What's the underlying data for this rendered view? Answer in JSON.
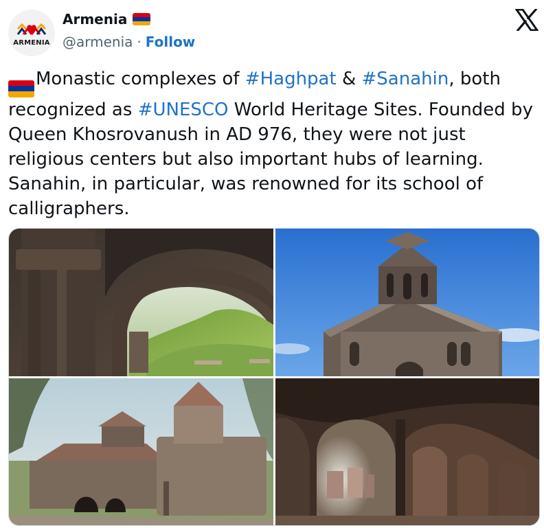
{
  "account": {
    "display_name": "Armenia",
    "handle": "@armenia",
    "separator": "·",
    "follow_label": "Follow",
    "avatar_text": "ARMENIA",
    "flag_colors": [
      "#d90012",
      "#0033a0",
      "#f2a800"
    ]
  },
  "header": {
    "x_logo_icon": "x-logo-icon"
  },
  "tweet": {
    "seg1": "Monastic complexes of ",
    "tag1": "#Haghpat",
    "seg2": " & ",
    "tag2": "#Sanahin",
    "seg3": ", both recognized as ",
    "tag3": "#UNESCO",
    "seg4": " World Heritage Sites. Founded by Queen Khosrovanush in AD 976, they were not just religious centers but also important hubs of learning. Sanahin, in particular, was renowned for its school of calligraphers."
  },
  "media": {
    "photos": [
      {
        "name": "photo-stone-arch-valley"
      },
      {
        "name": "photo-bell-tower-sky"
      },
      {
        "name": "photo-monastery-exterior"
      },
      {
        "name": "photo-arched-gallery"
      }
    ]
  },
  "colors": {
    "link": "#1d73c7",
    "text": "#0f1419",
    "muted": "#536471",
    "border": "#cfd9de"
  }
}
